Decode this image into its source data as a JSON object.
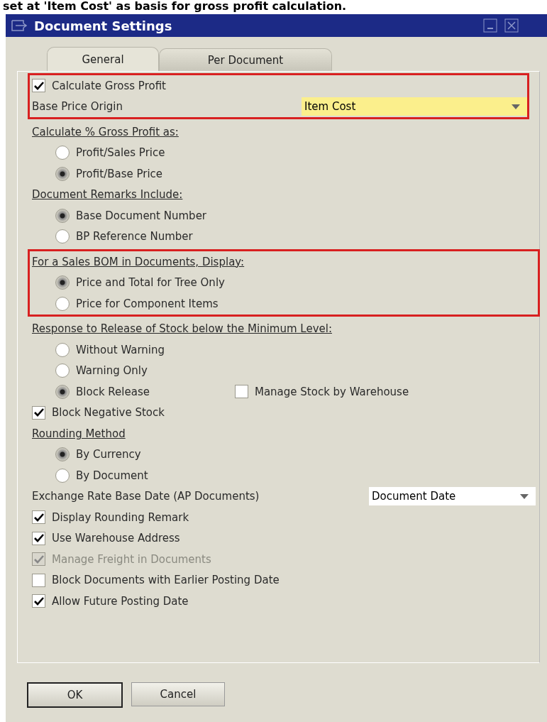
{
  "caption": "set at 'Item Cost' as basis for gross profit calculation.",
  "window": {
    "title": "Document Settings"
  },
  "tabs": [
    {
      "label": "General",
      "selected": true
    },
    {
      "label": "Per Document",
      "selected": false
    }
  ],
  "groups": [
    {
      "highlighted": true,
      "items": [
        {
          "kind": "checkbox",
          "label": "Calculate Gross Profit",
          "checked": true,
          "disabled": false
        },
        {
          "kind": "dropdown",
          "label": "Base Price Origin",
          "value": "Item Cost",
          "focused": true
        }
      ]
    },
    {
      "highlighted": false,
      "items": [
        {
          "kind": "heading",
          "label": "Calculate % Gross Profit as:"
        },
        {
          "kind": "radio",
          "label": "Profit/Sales Price",
          "selected": false
        },
        {
          "kind": "radio",
          "label": "Profit/Base Price",
          "selected": true
        },
        {
          "kind": "heading",
          "label": "Document Remarks Include:"
        },
        {
          "kind": "radio",
          "label": "Base Document Number",
          "selected": true
        },
        {
          "kind": "radio",
          "label": "BP Reference Number",
          "selected": false
        }
      ]
    },
    {
      "highlighted": true,
      "items": [
        {
          "kind": "heading",
          "label": "For a Sales BOM in Documents, Display:"
        },
        {
          "kind": "radio",
          "label": "Price and Total for Tree Only",
          "selected": true
        },
        {
          "kind": "radio",
          "label": "Price for Component Items",
          "selected": false
        }
      ]
    },
    {
      "highlighted": false,
      "items": [
        {
          "kind": "heading",
          "label": "Response to Release of Stock below the Minimum Level:"
        },
        {
          "kind": "radio",
          "label": "Without Warning",
          "selected": false
        },
        {
          "kind": "radio",
          "label": "Warning Only",
          "selected": false
        },
        {
          "kind": "radio",
          "label": "Block Release",
          "selected": true,
          "side_checkbox": {
            "label": "Manage Stock by Warehouse",
            "checked": false
          }
        },
        {
          "kind": "checkbox",
          "label": "Block Negative Stock",
          "checked": true,
          "disabled": false
        },
        {
          "kind": "heading",
          "label": "Rounding Method"
        },
        {
          "kind": "radio",
          "label": "By Currency",
          "selected": true
        },
        {
          "kind": "radio",
          "label": "By Document",
          "selected": false
        },
        {
          "kind": "dropdown",
          "label": "Exchange Rate Base Date (AP Documents)",
          "value": "Document Date",
          "focused": false
        },
        {
          "kind": "checkbox",
          "label": "Display Rounding Remark",
          "checked": true,
          "disabled": false
        },
        {
          "kind": "checkbox",
          "label": "Use Warehouse Address",
          "checked": true,
          "disabled": false
        },
        {
          "kind": "checkbox",
          "label": "Manage Freight in Documents",
          "checked": true,
          "disabled": true
        },
        {
          "kind": "checkbox",
          "label": "Block Documents with Earlier Posting Date",
          "checked": false,
          "disabled": false
        },
        {
          "kind": "checkbox",
          "label": "Allow Future Posting Date",
          "checked": true,
          "disabled": false
        }
      ]
    }
  ],
  "buttons": [
    {
      "label": "OK",
      "default": true
    },
    {
      "label": "Cancel",
      "default": false
    }
  ]
}
